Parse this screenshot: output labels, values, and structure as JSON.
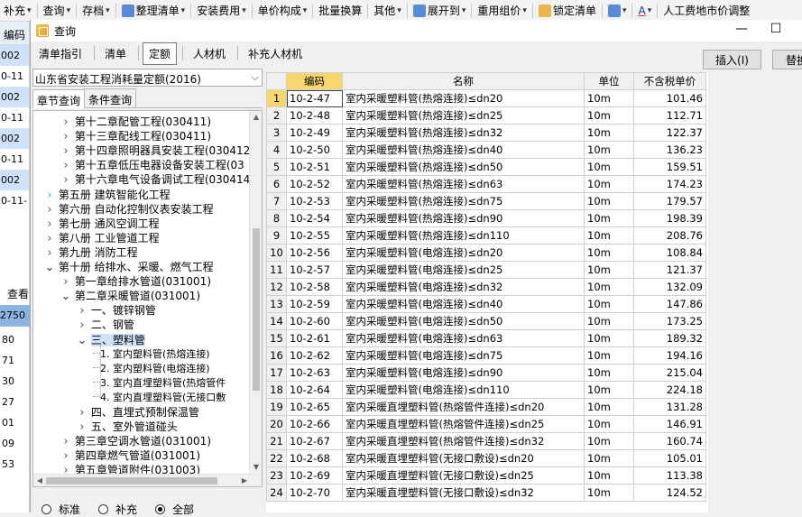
{
  "background": {
    "toolbar": [
      {
        "label": "补充",
        "caret": true
      },
      {
        "label": "查询",
        "caret": true
      },
      {
        "label": "存档",
        "caret": true
      },
      {
        "label": "整理清单",
        "caret": true,
        "icon": "sort-icon"
      },
      {
        "label": "安装费用",
        "caret": true
      },
      {
        "label": "单价构成",
        "caret": true
      },
      {
        "label": "批量换算",
        "caret": false
      },
      {
        "label": "其他",
        "caret": true
      },
      {
        "label": "展开到",
        "caret": true,
        "icon": "expand-icon"
      },
      {
        "label": "重用组价",
        "caret": true
      },
      {
        "label": "锁定清单",
        "caret": false,
        "icon": "lock-icon"
      },
      {
        "label": "",
        "caret": true,
        "icon": "paint-icon"
      },
      {
        "label": "A",
        "caret": true,
        "icon": "font-color-icon"
      },
      {
        "label": "人工费地市价调整",
        "caret": false
      }
    ],
    "left_header": "编码",
    "left_rows": [
      "002",
      "0-11",
      "002",
      "0-11",
      "002",
      "0-11",
      "002",
      "0-11-"
    ],
    "view_label": "查看",
    "left_hdr2": "2750",
    "left_nums": [
      "80",
      "71",
      "30",
      "27",
      "01",
      "09",
      "53"
    ]
  },
  "dialog": {
    "title": "查询",
    "window_buttons": [
      "—",
      "☐"
    ],
    "tabs": [
      "清单指引",
      "清单",
      "定额",
      "人材机",
      "补充人材机"
    ],
    "active_tab": 2,
    "insert_button": "插入(I)",
    "replace_button": "替换"
  },
  "left": {
    "library": "山东省安装工程消耗量定额(2016)",
    "subtabs": [
      "章节查询",
      "条件查询"
    ],
    "active_subtab": 0,
    "tree": [
      {
        "label": "第十二章配管工程(030411)",
        "level": 2,
        "arrow": "closed"
      },
      {
        "label": "第十三章配线工程(030411)",
        "level": 2,
        "arrow": "closed"
      },
      {
        "label": "第十四章照明器具安装工程(030412",
        "level": 2,
        "arrow": "closed"
      },
      {
        "label": "第十五章低压电器设备安装工程(03",
        "level": 2,
        "arrow": "closed"
      },
      {
        "label": "第十六章电气设备调试工程(030414",
        "level": 2,
        "arrow": "closed"
      },
      {
        "label": "第五册  建筑智能化工程",
        "level": 1,
        "arrow": "hl"
      },
      {
        "label": "第六册  自动化控制仪表安装工程",
        "level": 1,
        "arrow": "closed"
      },
      {
        "label": "第七册  通风空调工程",
        "level": 1,
        "arrow": "closed"
      },
      {
        "label": "第八册  工业管道工程",
        "level": 1,
        "arrow": "closed"
      },
      {
        "label": "第九册  消防工程",
        "level": 1,
        "arrow": "closed"
      },
      {
        "label": "第十册  给排水、采暖、燃气工程",
        "level": 1,
        "arrow": "open"
      },
      {
        "label": "第一章给排水管道(031001)",
        "level": 2,
        "arrow": "closed"
      },
      {
        "label": "第二章采暖管道(031001)",
        "level": 2,
        "arrow": "open"
      },
      {
        "label": "一、镀锌钢管",
        "level": 3,
        "arrow": "closed"
      },
      {
        "label": "二、钢管",
        "level": 3,
        "arrow": "closed"
      },
      {
        "label": "三、塑料管",
        "level": 3,
        "arrow": "open",
        "selected": true
      },
      {
        "label": "1. 室内塑料管(热熔连接)",
        "level": 4,
        "arrow": "none"
      },
      {
        "label": "2. 室内塑料管(电熔连接)",
        "level": 4,
        "arrow": "none"
      },
      {
        "label": "3. 室内直埋塑料管(热熔管件",
        "level": 4,
        "arrow": "none"
      },
      {
        "label": "4. 室内直埋塑料管(无接口敷",
        "level": 4,
        "arrow": "none"
      },
      {
        "label": "四、直埋式预制保温管",
        "level": 3,
        "arrow": "closed"
      },
      {
        "label": "五、室外管道碰头",
        "level": 3,
        "arrow": "closed"
      },
      {
        "label": "第三章空调水管道(031001)",
        "level": 2,
        "arrow": "closed"
      },
      {
        "label": "第四章燃气管道(031001)",
        "level": 2,
        "arrow": "closed"
      },
      {
        "label": "第五章管道附件(031003)",
        "level": 2,
        "arrow": "closed"
      }
    ],
    "radios": [
      "标准",
      "补充",
      "全部"
    ],
    "radio_selected": 2
  },
  "grid": {
    "columns": [
      "编码",
      "名称",
      "单位",
      "不含税单价"
    ],
    "rows": [
      {
        "n": "1",
        "code": "10-2-47",
        "name": "室内采暖塑料管(热熔连接)≤dn20",
        "unit": "10m",
        "price": "101.46"
      },
      {
        "n": "2",
        "code": "10-2-48",
        "name": "室内采暖塑料管(热熔连接)≤dn25",
        "unit": "10m",
        "price": "112.71"
      },
      {
        "n": "3",
        "code": "10-2-49",
        "name": "室内采暖塑料管(热熔连接)≤dn32",
        "unit": "10m",
        "price": "122.37"
      },
      {
        "n": "4",
        "code": "10-2-50",
        "name": "室内采暖塑料管(热熔连接)≤dn40",
        "unit": "10m",
        "price": "136.23"
      },
      {
        "n": "5",
        "code": "10-2-51",
        "name": "室内采暖塑料管(热熔连接)≤dn50",
        "unit": "10m",
        "price": "159.51"
      },
      {
        "n": "6",
        "code": "10-2-52",
        "name": "室内采暖塑料管(热熔连接)≤dn63",
        "unit": "10m",
        "price": "174.23"
      },
      {
        "n": "7",
        "code": "10-2-53",
        "name": "室内采暖塑料管(热熔连接)≤dn75",
        "unit": "10m",
        "price": "179.57"
      },
      {
        "n": "8",
        "code": "10-2-54",
        "name": "室内采暖塑料管(热熔连接)≤dn90",
        "unit": "10m",
        "price": "198.39"
      },
      {
        "n": "9",
        "code": "10-2-55",
        "name": "室内采暖塑料管(热熔连接)≤dn110",
        "unit": "10m",
        "price": "208.76"
      },
      {
        "n": "10",
        "code": "10-2-56",
        "name": "室内采暖塑料管(电熔连接)≤dn20",
        "unit": "10m",
        "price": "108.84"
      },
      {
        "n": "11",
        "code": "10-2-57",
        "name": "室内采暖塑料管(电熔连接)≤dn25",
        "unit": "10m",
        "price": "121.37"
      },
      {
        "n": "12",
        "code": "10-2-58",
        "name": "室内采暖塑料管(电熔连接)≤dn32",
        "unit": "10m",
        "price": "132.09"
      },
      {
        "n": "13",
        "code": "10-2-59",
        "name": "室内采暖塑料管(电熔连接)≤dn40",
        "unit": "10m",
        "price": "147.86"
      },
      {
        "n": "14",
        "code": "10-2-60",
        "name": "室内采暖塑料管(电熔连接)≤dn50",
        "unit": "10m",
        "price": "173.25"
      },
      {
        "n": "15",
        "code": "10-2-61",
        "name": "室内采暖塑料管(电熔连接)≤dn63",
        "unit": "10m",
        "price": "189.32"
      },
      {
        "n": "16",
        "code": "10-2-62",
        "name": "室内采暖塑料管(电熔连接)≤dn75",
        "unit": "10m",
        "price": "194.16"
      },
      {
        "n": "17",
        "code": "10-2-63",
        "name": "室内采暖塑料管(电熔连接)≤dn90",
        "unit": "10m",
        "price": "215.04"
      },
      {
        "n": "18",
        "code": "10-2-64",
        "name": "室内采暖塑料管(电熔连接)≤dn110",
        "unit": "10m",
        "price": "224.18"
      },
      {
        "n": "19",
        "code": "10-2-65",
        "name": "室内采暖直埋塑料管(热熔管件连接)≤dn20",
        "unit": "10m",
        "price": "131.28"
      },
      {
        "n": "20",
        "code": "10-2-66",
        "name": "室内采暖直埋塑料管(热熔管件连接)≤dn25",
        "unit": "10m",
        "price": "146.91"
      },
      {
        "n": "21",
        "code": "10-2-67",
        "name": "室内采暖直埋塑料管(热熔管件连接)≤dn32",
        "unit": "10m",
        "price": "160.74"
      },
      {
        "n": "22",
        "code": "10-2-68",
        "name": "室内采暖直埋塑料管(无接口敷设)≤dn20",
        "unit": "10m",
        "price": "105.01"
      },
      {
        "n": "23",
        "code": "10-2-69",
        "name": "室内采暖直埋塑料管(无接口敷设)≤dn25",
        "unit": "10m",
        "price": "113.38"
      },
      {
        "n": "24",
        "code": "10-2-70",
        "name": "室内采暖直埋塑料管(无接口敷设)≤dn32",
        "unit": "10m",
        "price": "124.52"
      }
    ],
    "current_row": 0
  }
}
